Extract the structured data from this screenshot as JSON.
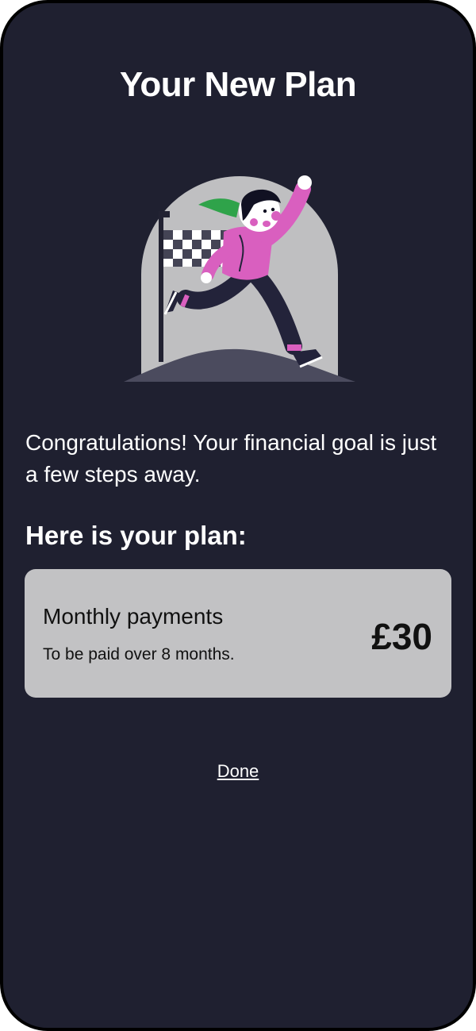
{
  "page": {
    "title": "Your New Plan"
  },
  "message": "Congratulations! Your financial goal is just a few steps away.",
  "plan": {
    "heading": "Here is your plan:",
    "label": "Monthly payments",
    "subtitle": "To be paid over 8 months.",
    "amount": "£30"
  },
  "actions": {
    "done_label": "Done"
  },
  "colors": {
    "background": "#1f2030",
    "card": "#c2c2c4",
    "accent_pink": "#d95fbf",
    "accent_green": "#2fa34a",
    "hill": "#4b4b5e",
    "arch": "#bfbfc1"
  },
  "illustration": {
    "icon": "runner-finish-flag-illustration"
  }
}
